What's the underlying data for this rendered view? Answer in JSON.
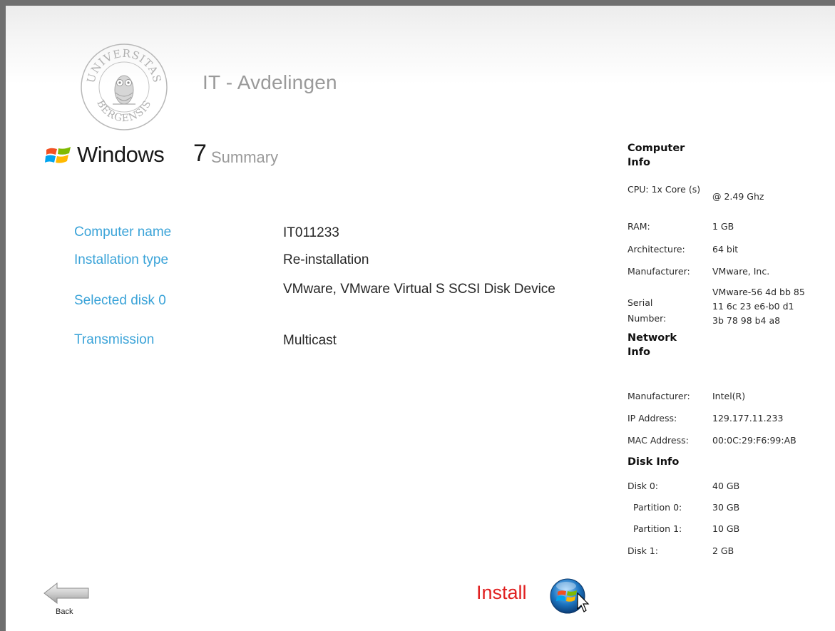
{
  "header": {
    "org_name": "IT - Avdelingen",
    "seal_text_top": "UNIVERSITAS",
    "seal_text_bottom": "BERGENSIS"
  },
  "product": {
    "name": "Windows",
    "version": "7",
    "page_title": "Summary"
  },
  "summary": [
    {
      "label": "Computer name",
      "value": "IT011233"
    },
    {
      "label": "Installation type",
      "value": "Re-installation"
    },
    {
      "label": "Selected disk 0",
      "value": "VMware, VMware Virtual S SCSI Disk Device"
    },
    {
      "label": "Transmission",
      "value": "Multicast"
    }
  ],
  "computer_info": {
    "title": "Computer Info",
    "cpu_label": "CPU: 1x Core (s)",
    "cpu_value": "@ 2.49 Ghz",
    "ram_label": "RAM:",
    "ram_value": "1 GB",
    "arch_label": "Architecture:",
    "arch_value": "64 bit",
    "mfr_label": "Manufacturer:",
    "mfr_value": "VMware, Inc.",
    "serial_label": "Serial Number:",
    "serial_value_1": "VMware-56 4d bb 85",
    "serial_value_2": "11 6c 23 e6-b0 d1",
    "serial_value_3": "3b 78 98 b4 a8"
  },
  "network_info": {
    "title": "Network Info",
    "mfr_label": "Manufacturer:",
    "mfr_value": "Intel(R)",
    "ip_label": "IP Address:",
    "ip_value": "129.177.11.233",
    "mac_label": "MAC Address:",
    "mac_value": "00:0C:29:F6:99:AB"
  },
  "disk_info": {
    "title": "Disk Info",
    "rows": [
      {
        "label": "Disk 0:",
        "value": "40 GB"
      },
      {
        "label": "Partition 0:",
        "value": "30 GB"
      },
      {
        "label": "Partition 1:",
        "value": "10 GB"
      },
      {
        "label": "Disk 1:",
        "value": "2 GB"
      }
    ]
  },
  "actions": {
    "back_label": "Back",
    "install_label": "Install"
  },
  "icons": {
    "seal": "university-seal-icon",
    "windows": "windows-logo-icon",
    "back": "back-arrow-icon",
    "install": "windows-orb-icon"
  },
  "colors": {
    "label_blue": "#3aa3d8",
    "install_red": "#e02020",
    "heading_gray": "#9a9a9a"
  }
}
